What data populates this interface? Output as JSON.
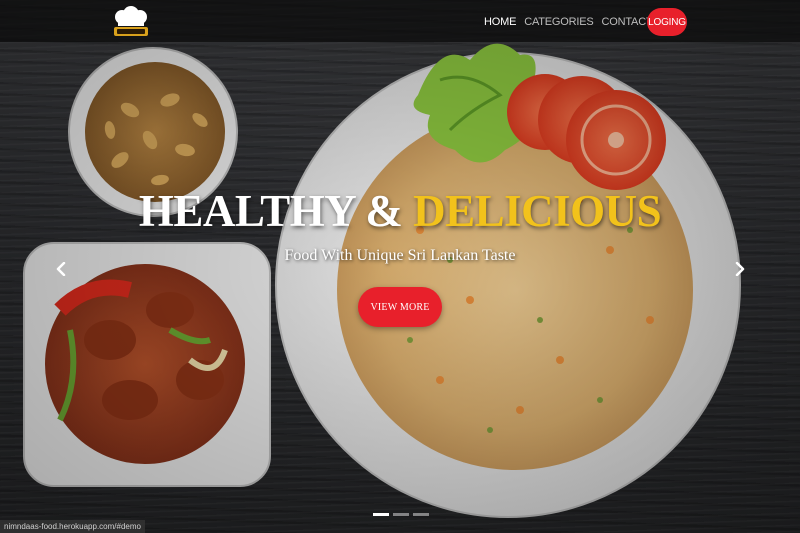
{
  "nav": {
    "brand_logo": "chef-hat-logo",
    "links": [
      {
        "label": "HOME",
        "active": true
      },
      {
        "label": "CATEGORIES",
        "active": false
      },
      {
        "label": "CONTACT US",
        "active": false
      }
    ],
    "login_label": "LOGING"
  },
  "hero": {
    "headline_white": "HEALTHY & ",
    "headline_yellow": "DELICIOUS",
    "subtitle": "Food With Unique Sri Lankan Taste",
    "cta_label": "VIEW MORE",
    "slides_count": 3,
    "active_slide": 1
  },
  "controls": {
    "prev_icon": "chevron-left-icon",
    "next_icon": "chevron-right-icon"
  },
  "status_bar": {
    "url": "nimndaas-food.herokuapp.com/#demo"
  },
  "colors": {
    "accent_red": "#e8202b",
    "accent_yellow": "#f2c21b",
    "nav_bg": "#0a0a0a",
    "text_white": "#ffffff"
  }
}
